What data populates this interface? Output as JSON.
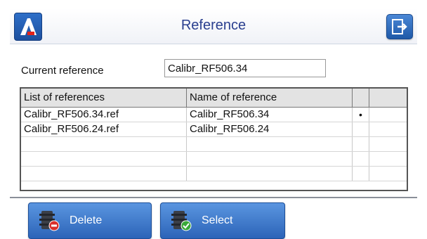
{
  "header": {
    "title": "Reference",
    "logo_icon": "app-logo-icon",
    "exit_icon": "exit-icon"
  },
  "current_reference": {
    "label": "Current reference",
    "value": "Calibr_RF506.34"
  },
  "table": {
    "columns": [
      "List of references",
      "Name of reference",
      "",
      ""
    ],
    "rows": [
      {
        "file": "Calibr_RF506.34.ref",
        "name": "Calibr_RF506.34",
        "mark": "•"
      },
      {
        "file": "Calibr_RF506.24.ref",
        "name": "Calibr_RF506.24",
        "mark": ""
      },
      {
        "file": "",
        "name": "",
        "mark": ""
      },
      {
        "file": "",
        "name": "",
        "mark": ""
      },
      {
        "file": "",
        "name": "",
        "mark": ""
      }
    ]
  },
  "buttons": {
    "delete": {
      "label": "Delete",
      "icon": "delete-icon"
    },
    "select": {
      "label": "Select",
      "icon": "select-icon"
    }
  },
  "colors": {
    "accent": "#2c64b8",
    "title": "#2a3f8f"
  }
}
